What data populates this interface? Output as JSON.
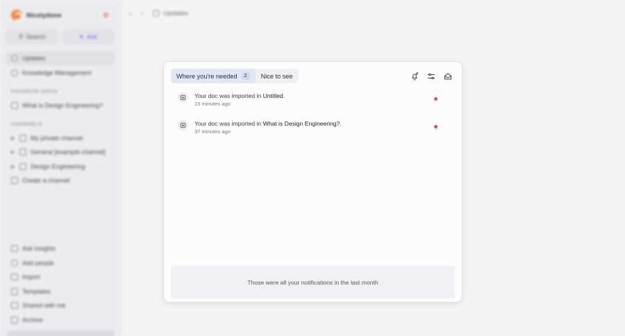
{
  "sidebar": {
    "workspace_name": "Nicelydone",
    "search_label": "Search",
    "ask_label": "Ask",
    "items": [
      {
        "label": "Updates",
        "icon": "clock-icon"
      },
      {
        "label": "Knowledge Management",
        "icon": "globe-icon"
      }
    ],
    "favorite_docs_title": "FAVORITE DOCS",
    "favorite_docs": [
      {
        "label": "What is Design Engineering?",
        "icon": "doc-icon"
      }
    ],
    "channels_title": "CHANNELS",
    "channels": [
      {
        "label": "My private channel",
        "icon": "lock-icon"
      },
      {
        "label": "General [example channel]",
        "icon": "hash-icon"
      },
      {
        "label": "Design Engineering",
        "icon": "lock-icon"
      }
    ],
    "create_channel_label": "Create a channel",
    "bottom_items": [
      {
        "label": "Ask insights",
        "icon": "sparkle-icon"
      },
      {
        "label": "Add people",
        "icon": "user-plus-icon"
      },
      {
        "label": "Import",
        "icon": "import-icon"
      },
      {
        "label": "Templates",
        "icon": "template-icon"
      },
      {
        "label": "Shared with me",
        "icon": "share-icon"
      },
      {
        "label": "Archive",
        "icon": "archive-icon"
      }
    ]
  },
  "topbar": {
    "breadcrumb": "Updates"
  },
  "panel": {
    "tabs": [
      {
        "label": "Where you're needed",
        "count": "2"
      },
      {
        "label": "Nice to see"
      }
    ],
    "notifications": [
      {
        "prefix": "Your doc was imported in ",
        "target": "Untitled",
        "suffix": ".",
        "time": "15 minutes ago"
      },
      {
        "prefix": "Your doc was imported in ",
        "target": "What is Design Engineering?",
        "suffix": ".",
        "time": "37 minutes ago"
      }
    ],
    "footer_text": "Those were all your notifications in the last month"
  },
  "colors": {
    "accent_tab_bg": "#e2e8f3",
    "unread_dot": "#e5484d",
    "brand_logo": "#f08a4b"
  }
}
